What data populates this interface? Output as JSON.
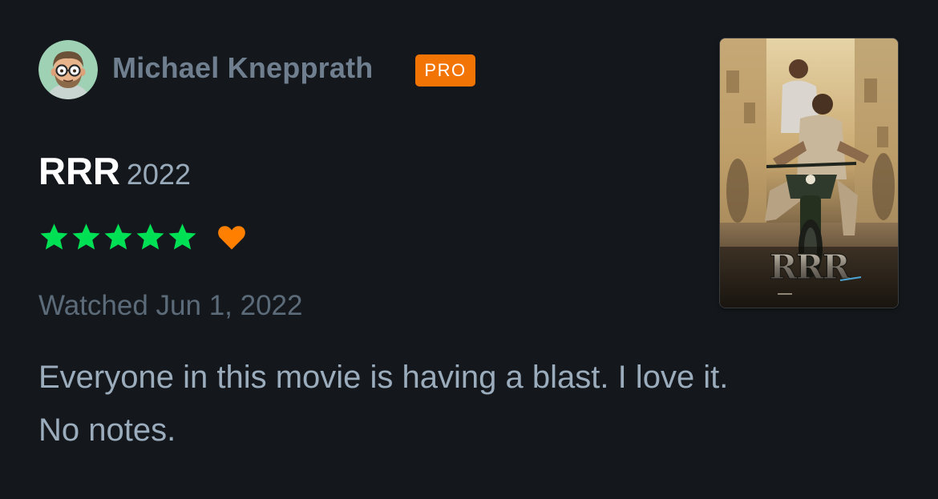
{
  "review": {
    "username": "Michael Knepprath",
    "badge": "PRO",
    "film_title": "RRR",
    "film_year": "2022",
    "rating_stars": 5,
    "liked": true,
    "watched_text": "Watched Jun 1, 2022",
    "text_line1": "Everyone in this movie is having a blast. I love it.",
    "text_line2": "No notes.",
    "poster_logo": "RRR"
  },
  "colors": {
    "background": "#14181c",
    "username": "#6f7f8f",
    "badge": "#f27405",
    "star": "#00e054",
    "heart": "#ff8000",
    "body_text": "#9bacbd"
  },
  "icons": {
    "avatar": "cartoon-face-with-glasses",
    "star": "star-icon",
    "heart": "heart-icon"
  }
}
